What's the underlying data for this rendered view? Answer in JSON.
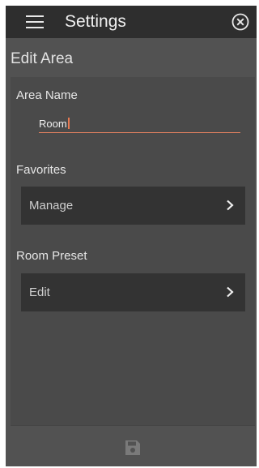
{
  "header": {
    "title": "Settings",
    "menu_icon": "hamburger-menu-icon",
    "close_icon": "close-circle-icon"
  },
  "page": {
    "heading": "Edit Area"
  },
  "area_name": {
    "label": "Area Name",
    "value": "Room"
  },
  "favorites": {
    "label": "Favorites",
    "button_label": "Manage",
    "chevron_icon": "chevron-right-icon"
  },
  "room_preset": {
    "label": "Room Preset",
    "button_label": "Edit",
    "chevron_icon": "chevron-right-icon"
  },
  "footer": {
    "save_icon": "floppy-disk-icon"
  },
  "colors": {
    "topbar": "#2e2e2e",
    "background": "#525252",
    "panel": "#4a4a4a",
    "button": "#333333",
    "accent": "#e07f5f",
    "disabled_icon": "#7a7a7a"
  }
}
